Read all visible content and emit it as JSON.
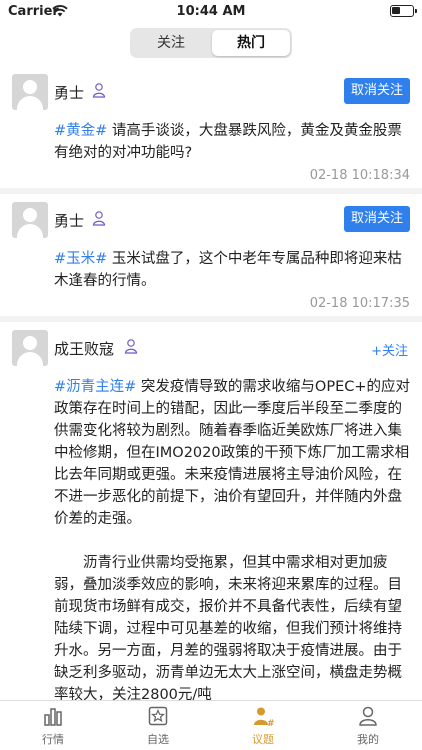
{
  "status": {
    "carrier": "Carrier",
    "time": "10:44 AM"
  },
  "segment": {
    "left": "关注",
    "right": "热门"
  },
  "posts": [
    {
      "user": "勇士",
      "action": "取消关注",
      "tag": "#黄金#",
      "text": " 请高手谈谈，大盘暴跌风险，黄金及黄金股票有绝对的对冲功能吗?",
      "time": "02-18 10:18:34"
    },
    {
      "user": "勇士",
      "action": "取消关注",
      "tag": "#玉米#",
      "text": " 玉米试盘了，这个中老年专属品种即将迎来枯木逢春的行情。",
      "time": "02-18 10:17:35"
    },
    {
      "user": "成王败寇",
      "action": "+关注",
      "tag": "#沥青主连#",
      "text": " 突发疫情导致的需求收缩与OPEC+的应对政策存在时间上的错配，因此一季度后半段至二季度的供需变化将较为剧烈。随着春季临近美欧炼厂将进入集中检修期，但在IMO2020政策的干预下炼厂加工需求相比去年同期或更强。未来疫情进展将主导油价风险，在不进一步恶化的前提下，油价有望回升，并伴随内外盘价差的走强。",
      "text2": "沥青行业供需均受拖累，但其中需求相对更加疲弱，叠加淡季效应的影响，未来将迎来累库的过程。目前现货市场鲜有成交，报价并不具备代表性，后续有望陆续下调，过程中可见基差的收缩，但我们预计将维持升水。另一方面，月差的强弱将取决于疫情进展。由于缺乏利多驱动，沥青单边无太大上涨空间，横盘走势概率较大，关注2800元/吨"
    }
  ],
  "tabbar": [
    {
      "label": "行情",
      "icon": "chart-bars-icon"
    },
    {
      "label": "自选",
      "icon": "star-square-icon"
    },
    {
      "label": "议题",
      "icon": "user-hash-icon",
      "active": true
    },
    {
      "label": "我的",
      "icon": "profile-icon"
    }
  ],
  "colors": {
    "accent": "#2f80ed",
    "tab_active": "#d79a2e"
  }
}
